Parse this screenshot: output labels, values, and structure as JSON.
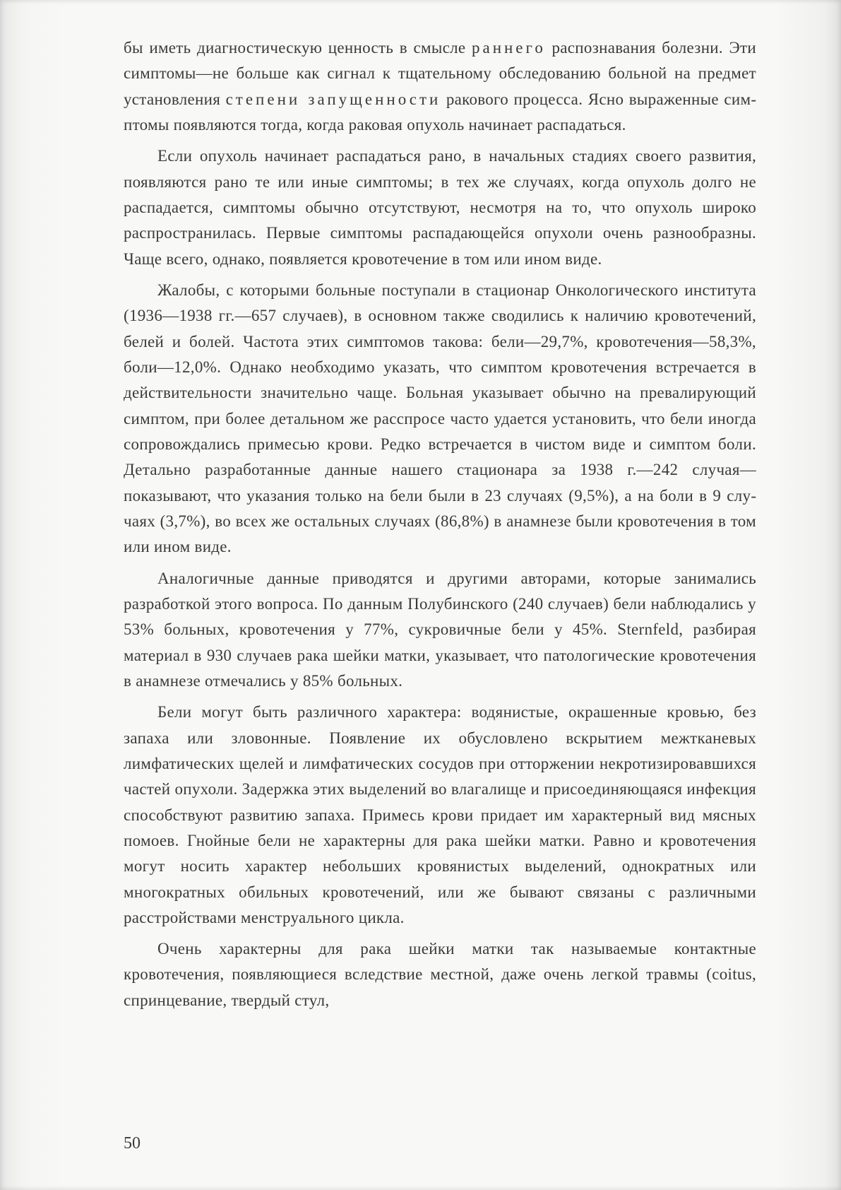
{
  "page_number": "50",
  "paragraphs": {
    "p1_pre": "бы иметь диагностическую ценность в смысле ",
    "p1_sp1": "раннего",
    "p1_mid": " распо­знавания болезни. Эти симптомы—не больше как сигнал к тща­тельному обследованию больной на предмет установления ",
    "p1_sp2": "степе­ни запущенности",
    "p1_post": " ракового процесса. Ясно выраженные сим­птомы появляются тогда, когда раковая опухоль начинает распа­даться.",
    "p2": "Если опухоль начинает распадаться рано, в начальных стадиях своего развития, появляются рано те или иные сим­птомы; в тех же случаях, когда опухоль долго не распадается, сим­птомы обычно отсутствуют, несмотря на то, что опухоль широко распространилась. Первые симптомы распадающейся опухоли очень разнообразны. Чаще всего, однако, появляется кровоте­чение в том или ином виде.",
    "p3": "Жалобы, с которыми больные поступали в стационар Онко­логического института (1936—1938 гг.—657 случаев), в основ­ном также сводились к наличию кровотечений, белей и болей. Частота этих симптомов такова: бели—29,7%, кровотечения—58,3%, боли—12,0%. Однако необходимо указать, что симптом кровотечения встречается в действительности значительно чаще. Больная указывает обычно на превалирующий симптом, при более детальном же расспросе часто удается установить, что бели иног­да сопровождались примесью крови. Редко встречается в чис­том виде и симптом боли. Детально разработанные данные нашего стационара за 1938 г.—242 случая—показывают, что указания только на бели были в 23 случаях (9,5%), а на боли в 9 слу­чаях (3,7%), во всех же остальных случаях (86,8%) в анамнезе были кровотечения в том или ином виде.",
    "p4": "Аналогичные данные приводятся и другими авторами, которые занимались разработкой этого вопроса. По данным Полубин­ского (240 случаев) бели наблюдались у 53% больных, кро­вотечения у 77%, сукровичные бели у 45%. Sternfeld, разбирая материал в 930 случаев рака шейки матки, указывает, что пато­логические кровотечения в анамнезе отмечались у 85% больных.",
    "p5": "Бели могут быть различного характера: водянистые, окра­шенные кровью, без запаха или зловонные. Появление их обус­ловлено вскрытием межтканевых лимфатических щелей и лимфати­ческих сосудов при отторжении некротизировавшихся частей опухоли. Задержка этих выделений во влагалище и присоеди­няющаяся инфекция способствуют развитию запаха. Примесь крови придает им характерный вид мясных помоев. Гнойные бели не характерны для рака шейки матки. Равно и кровотече­ния могут носить характер небольших кровянистых выделений, однократных или многократных обильных кровотечений, или же бывают связаны с различными расстройствами менструального цикла.",
    "p6": "Очень характерны для рака шейки матки так называемые контактные кровотечения, появляющиеся вследствие местной, даже очень легкой травмы (coitus, спринцевание, твердый стул,"
  }
}
